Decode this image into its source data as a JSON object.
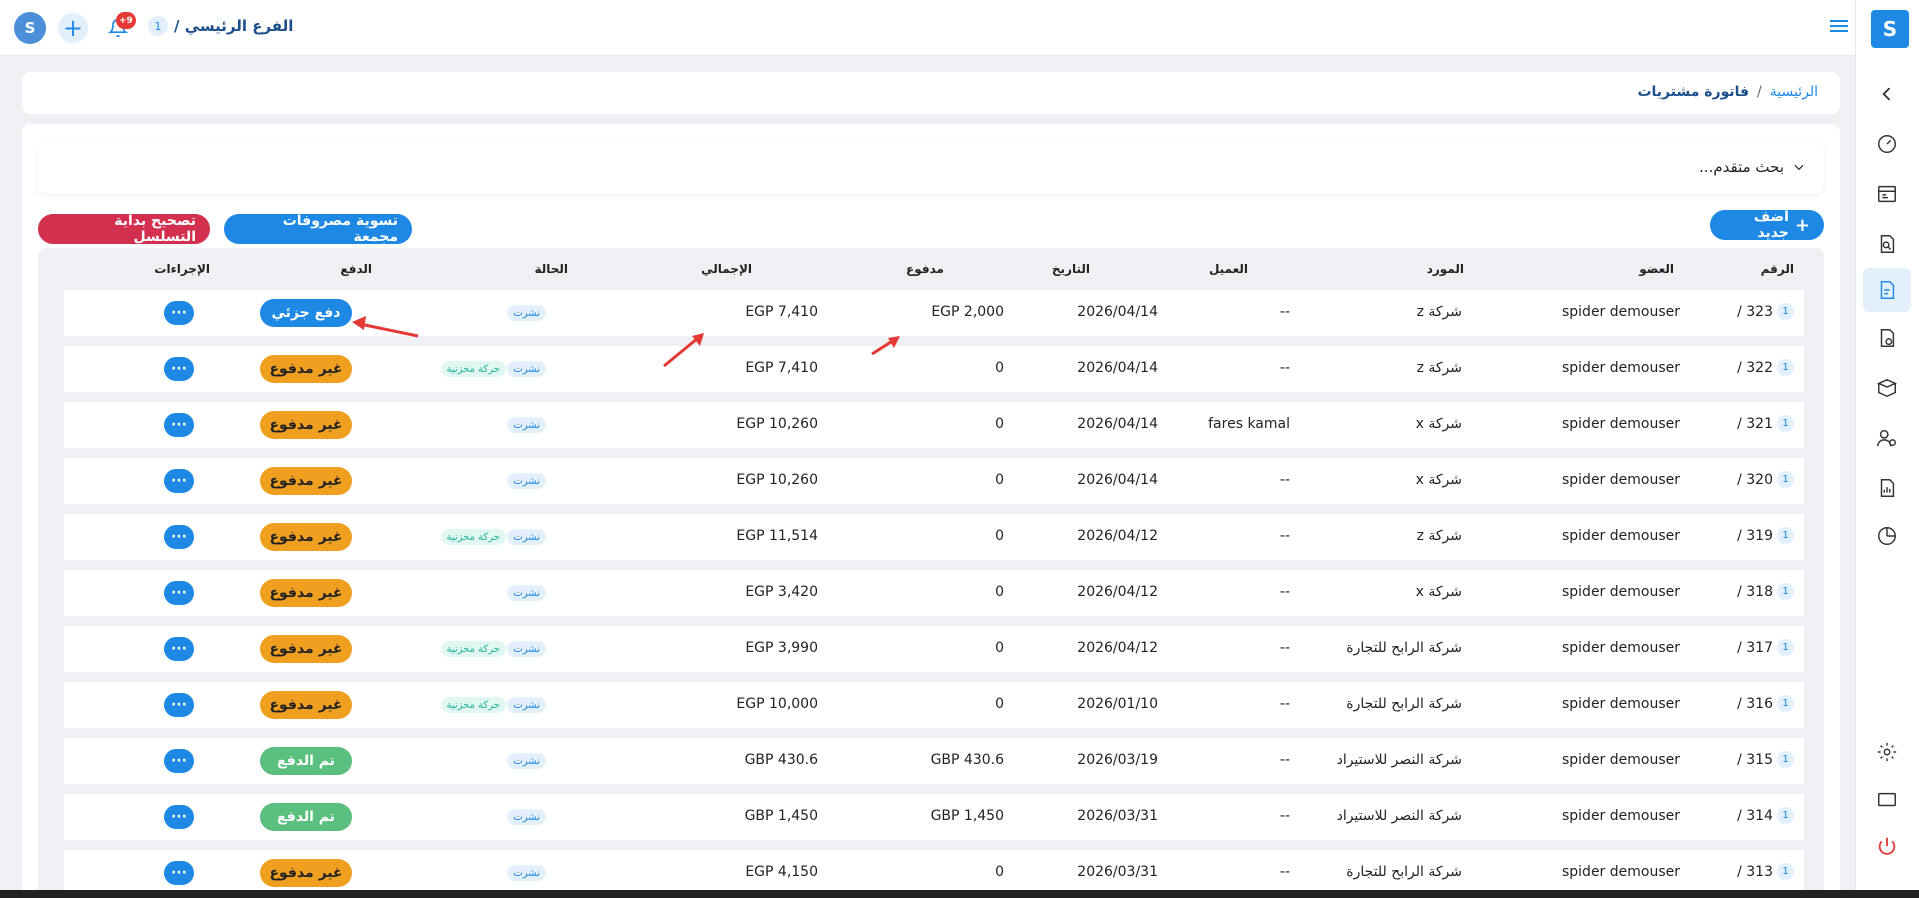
{
  "topbar": {
    "branch_label": "الفرع الرئيسي /",
    "branch_count": "1",
    "notification_count": "+9"
  },
  "breadcrumb": {
    "home": "الرئيسية",
    "separator": "/",
    "current": "فاتورة مشتريات"
  },
  "search": {
    "label": "بحث متقدم..."
  },
  "buttons": {
    "add_new": "أضف جديد",
    "add_new_icon": "+",
    "settle_expenses": "تسوية مصروفات مجمعة",
    "fix_sequence": "تصحيح بداية التسلسل"
  },
  "table": {
    "headers": {
      "number": "الرقم",
      "member": "العضو",
      "supplier": "المورد",
      "client": "العميل",
      "date": "التاريخ",
      "paid": "مدفوع",
      "total": "الإجمالي",
      "status": "الحالة",
      "payment": "الدفع",
      "actions": "الإجراءات"
    },
    "rows": [
      {
        "number": "323 /",
        "count": "1",
        "member": "spider demouser",
        "supplier": "شركة z",
        "client": "--",
        "date": "2026/04/14",
        "paid": "EGP 2,000",
        "total": "EGP 7,410",
        "status": "نشرت",
        "inventory": "",
        "payment": "دفع جزئي",
        "payment_type": "partial"
      },
      {
        "number": "322 /",
        "count": "1",
        "member": "spider demouser",
        "supplier": "شركة z",
        "client": "--",
        "date": "2026/04/14",
        "paid": "0",
        "total": "EGP 7,410",
        "status": "نشرت",
        "inventory": "حركة مخزنية",
        "payment": "غير مدفوع",
        "payment_type": "unpaid"
      },
      {
        "number": "321 /",
        "count": "1",
        "member": "spider demouser",
        "supplier": "شركة x",
        "client": "fares kamal",
        "date": "2026/04/14",
        "paid": "0",
        "total": "EGP 10,260",
        "status": "نشرت",
        "inventory": "",
        "payment": "غير مدفوع",
        "payment_type": "unpaid"
      },
      {
        "number": "320 /",
        "count": "1",
        "member": "spider demouser",
        "supplier": "شركة x",
        "client": "--",
        "date": "2026/04/14",
        "paid": "0",
        "total": "EGP 10,260",
        "status": "نشرت",
        "inventory": "",
        "payment": "غير مدفوع",
        "payment_type": "unpaid"
      },
      {
        "number": "319 /",
        "count": "1",
        "member": "spider demouser",
        "supplier": "شركة z",
        "client": "--",
        "date": "2026/04/12",
        "paid": "0",
        "total": "EGP 11,514",
        "status": "نشرت",
        "inventory": "حركة مخزنية",
        "payment": "غير مدفوع",
        "payment_type": "unpaid"
      },
      {
        "number": "318 /",
        "count": "1",
        "member": "spider demouser",
        "supplier": "شركة x",
        "client": "--",
        "date": "2026/04/12",
        "paid": "0",
        "total": "EGP 3,420",
        "status": "نشرت",
        "inventory": "",
        "payment": "غير مدفوع",
        "payment_type": "unpaid"
      },
      {
        "number": "317 /",
        "count": "1",
        "member": "spider demouser",
        "supplier": "شركة الرابح للتجارة",
        "client": "--",
        "date": "2026/04/12",
        "paid": "0",
        "total": "EGP 3,990",
        "status": "نشرت",
        "inventory": "حركة مخزنية",
        "payment": "غير مدفوع",
        "payment_type": "unpaid"
      },
      {
        "number": "316 /",
        "count": "1",
        "member": "spider demouser",
        "supplier": "شركة الرابح للتجارة",
        "client": "--",
        "date": "2026/01/10",
        "paid": "0",
        "total": "EGP 10,000",
        "status": "نشرت",
        "inventory": "حركة مخزنية",
        "payment": "غير مدفوع",
        "payment_type": "unpaid"
      },
      {
        "number": "315 /",
        "count": "1",
        "member": "spider demouser",
        "supplier": "شركة النصر للاستيراد",
        "client": "--",
        "date": "2026/03/19",
        "paid": "GBP 430.6",
        "total": "GBP 430.6",
        "status": "نشرت",
        "inventory": "",
        "payment": "تم الدفع",
        "payment_type": "paid"
      },
      {
        "number": "314 /",
        "count": "1",
        "member": "spider demouser",
        "supplier": "شركة النصر للاستيراد",
        "client": "--",
        "date": "2026/03/31",
        "paid": "GBP 1,450",
        "total": "GBP 1,450",
        "status": "نشرت",
        "inventory": "",
        "payment": "تم الدفع",
        "payment_type": "paid"
      },
      {
        "number": "313 /",
        "count": "1",
        "member": "spider demouser",
        "supplier": "شركة الرابح للتجارة",
        "client": "--",
        "date": "2026/03/31",
        "paid": "0",
        "total": "EGP 4,150",
        "status": "نشرت",
        "inventory": "",
        "payment": "غير مدفوع",
        "payment_type": "unpaid"
      }
    ],
    "actions_label": "···"
  },
  "colors": {
    "accent": "#1e88e5",
    "danger": "#d32f4f",
    "unpaid": "#f0a020",
    "paid": "#5bbf7f",
    "arrow": "#e53935"
  },
  "sidebar_icons": [
    "chevron-left-icon",
    "dashboard-icon",
    "register-icon",
    "search-doc-icon",
    "purchase-invoice-icon",
    "return-doc-icon",
    "products-icon",
    "users-icon",
    "reports-icon",
    "analytics-icon",
    "settings-icon",
    "display-icon",
    "power-icon"
  ]
}
